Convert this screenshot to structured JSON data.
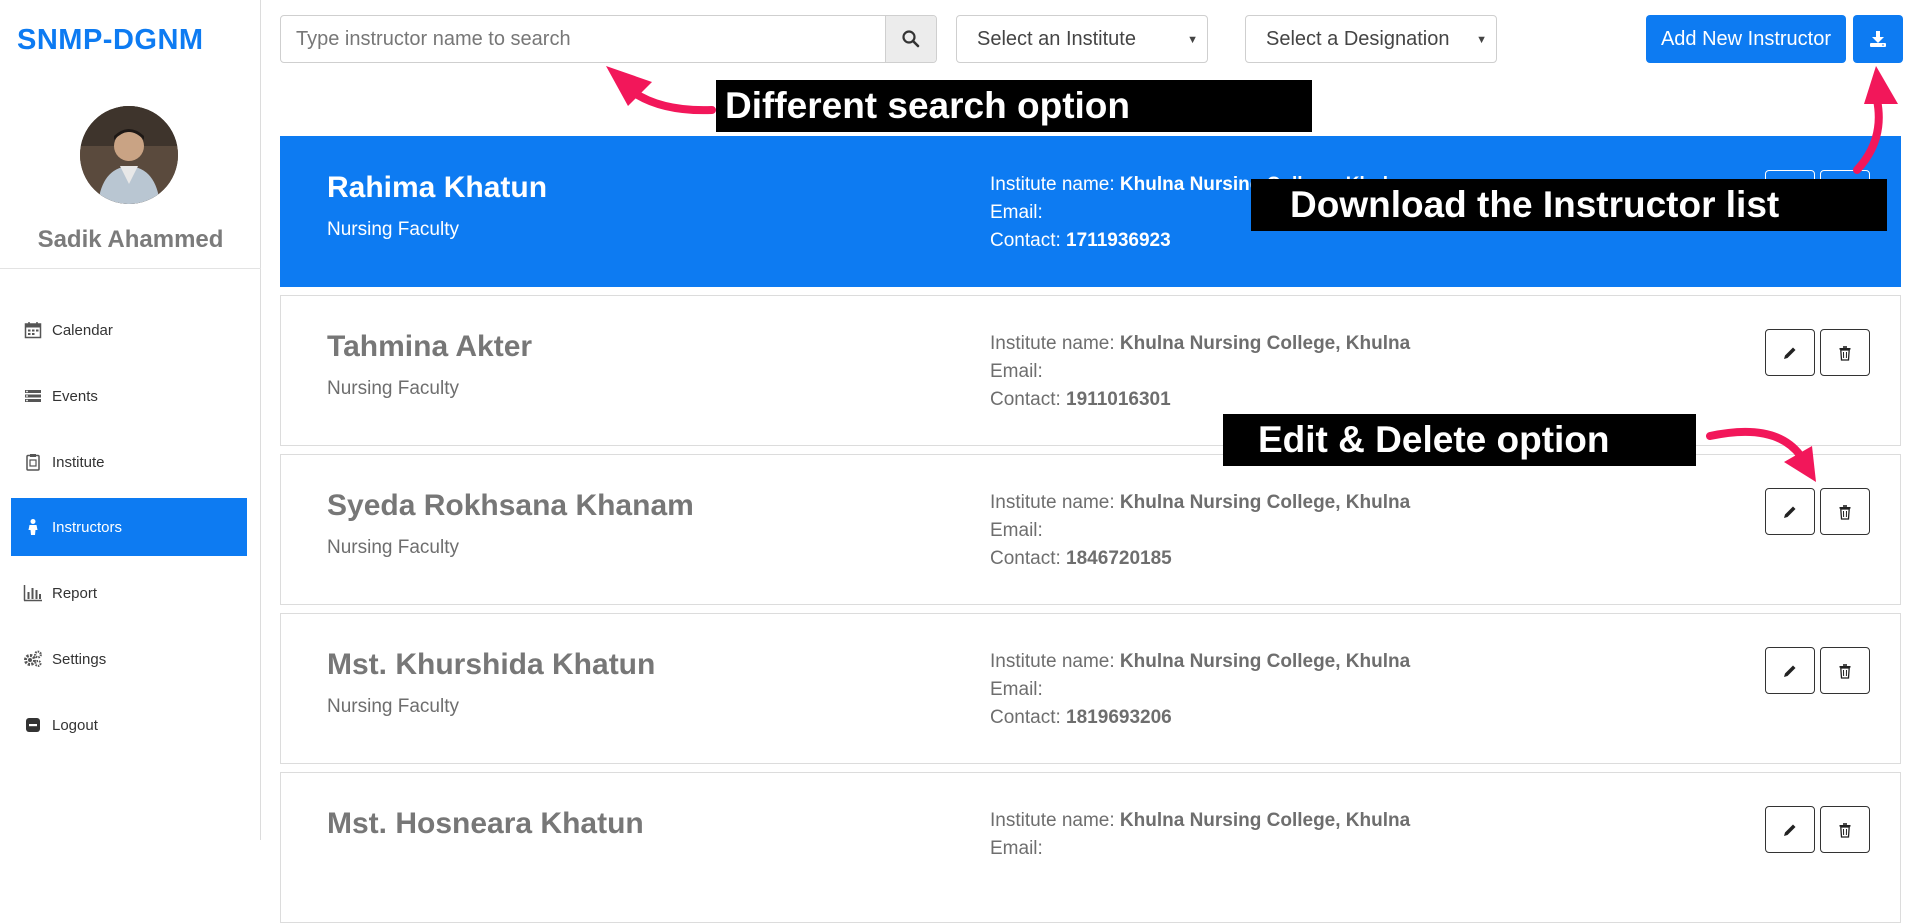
{
  "app": {
    "brand": "SNMP-DGNM"
  },
  "user": {
    "name": "Sadik Ahammed"
  },
  "sidebar": {
    "items": [
      {
        "label": "Calendar",
        "icon": "calendar-icon"
      },
      {
        "label": "Events",
        "icon": "events-icon"
      },
      {
        "label": "Institute",
        "icon": "clipboard-icon"
      },
      {
        "label": "Instructors",
        "icon": "person-icon",
        "active": true
      },
      {
        "label": "Report",
        "icon": "bar-chart-icon"
      },
      {
        "label": "Settings",
        "icon": "gears-icon"
      },
      {
        "label": "Logout",
        "icon": "logout-icon"
      }
    ]
  },
  "toolbar": {
    "search_placeholder": "Type instructor name to search",
    "institute_select": "Select an Institute",
    "designation_select": "Select a Designation",
    "add_button": "Add New Instructor"
  },
  "labels": {
    "institute": "Institute name:",
    "email": "Email:",
    "contact": "Contact:"
  },
  "instructors": [
    {
      "name": "Rahima Khatun",
      "role": "Nursing Faculty",
      "institute": "Khulna Nursing College, Khulna",
      "email": "",
      "contact": "1711936923"
    },
    {
      "name": "Tahmina Akter",
      "role": "Nursing Faculty",
      "institute": "Khulna Nursing College, Khulna",
      "email": "",
      "contact": "1911016301"
    },
    {
      "name": "Syeda Rokhsana Khanam",
      "role": "Nursing Faculty",
      "institute": "Khulna Nursing College, Khulna",
      "email": "",
      "contact": "1846720185"
    },
    {
      "name": "Mst. Khurshida Khatun",
      "role": "Nursing Faculty",
      "institute": "Khulna Nursing College, Khulna",
      "email": "",
      "contact": "1819693206"
    },
    {
      "name": "Mst. Hosneara Khatun",
      "role": "",
      "institute": "Khulna Nursing College, Khulna",
      "email": "",
      "contact": ""
    }
  ],
  "annotations": {
    "search": "Different search option",
    "download": "Download the Instructor list",
    "edit_delete": "Edit & Delete option"
  },
  "colors": {
    "primary": "#0d7bf2",
    "annotation_bg": "#000000",
    "annotation_arrow": "#f2175a"
  }
}
